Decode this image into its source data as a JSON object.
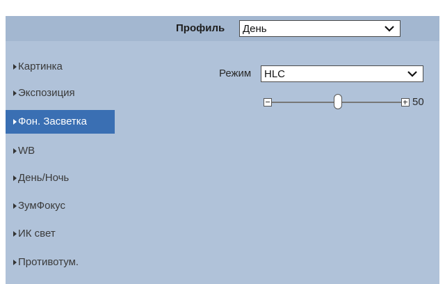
{
  "header": {
    "profile_label": "Профиль",
    "profile_value": "День"
  },
  "sidebar": {
    "items": [
      {
        "label": "Картинка",
        "active": false
      },
      {
        "label": "Экспозиция",
        "active": false
      },
      {
        "label": "Фон. Засветка",
        "active": true
      },
      {
        "label": "WB",
        "active": false
      },
      {
        "label": "День/Ночь",
        "active": false
      },
      {
        "label": "ЗумФокус",
        "active": false
      },
      {
        "label": "ИК свет",
        "active": false
      },
      {
        "label": "Противотум.",
        "active": false
      }
    ]
  },
  "content": {
    "mode_label": "Режим",
    "mode_value": "HLC",
    "slider_value": "50"
  },
  "colors": {
    "panel": "#b0c2d9",
    "header": "#a3b7d0",
    "active": "#3a6fb3"
  },
  "icons": {
    "dropdown": "chevron-down-icon",
    "nav": "caret-right-icon",
    "minus": "minus-icon",
    "plus": "plus-icon"
  }
}
